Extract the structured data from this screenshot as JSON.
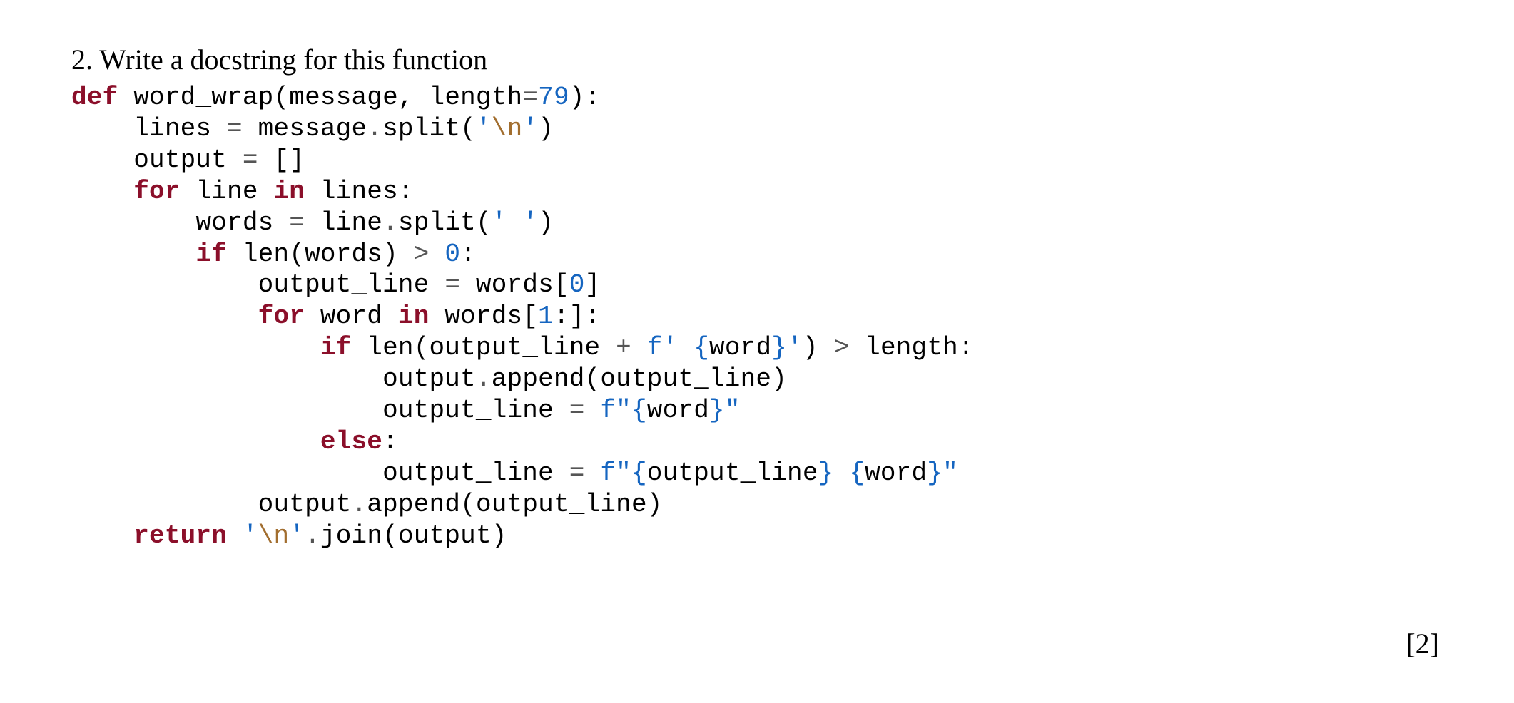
{
  "question": {
    "number": "2.",
    "prompt": "Write a docstring for this function"
  },
  "points_label": "[2]",
  "code": {
    "l1": {
      "kw_def": "def",
      "fname": " word_wrap",
      "lparen": "(",
      "arg1": "message",
      "comma": ", ",
      "arg2": "length",
      "eq": "=",
      "default": "79",
      "rparen": ")",
      "colon": ":"
    },
    "l2": {
      "indent": "    ",
      "lhs": "lines ",
      "eq": "=",
      "rhs1": " message",
      "dot": ".",
      "call": "split",
      "lparen": "(",
      "q1": "'",
      "esc": "\\n",
      "q2": "'",
      "rparen": ")"
    },
    "l3": {
      "indent": "    ",
      "lhs": "output ",
      "eq": "=",
      "sp": " ",
      "lbracket": "[",
      "rbracket": "]"
    },
    "l4": {
      "indent": "    ",
      "kw_for": "for",
      "var": " line ",
      "kw_in": "in",
      "iter": " lines",
      "colon": ":"
    },
    "l5": {
      "indent": "        ",
      "lhs": "words ",
      "eq": "=",
      "rhs1": " line",
      "dot": ".",
      "call": "split",
      "lparen": "(",
      "q1": "'",
      "sp": " ",
      "q2": "'",
      "rparen": ")"
    },
    "l6": {
      "indent": "        ",
      "kw_if": "if",
      "sp": " ",
      "fn": "len",
      "lparen": "(",
      "arg": "words",
      "rparen": ")",
      "sp2": " ",
      "gt": ">",
      "sp3": " ",
      "zero": "0",
      "colon": ":"
    },
    "l7": {
      "indent": "            ",
      "lhs": "output_line ",
      "eq": "=",
      "rhs": " words",
      "lbracket": "[",
      "idx": "0",
      "rbracket": "]"
    },
    "l8": {
      "indent": "            ",
      "kw_for": "for",
      "var": " word ",
      "kw_in": "in",
      "iter": " words",
      "lbracket": "[",
      "start": "1",
      "colon_slice": ":",
      "rbracket": "]",
      "colon": ":"
    },
    "l9": {
      "indent": "                ",
      "kw_if": "if",
      "sp": " ",
      "fn": "len",
      "lparen": "(",
      "arg1": "output_line ",
      "plus": "+",
      "sp2": " ",
      "fpfx": "f",
      "q1": "'",
      "lit_sp": " ",
      "lbrace": "{",
      "expr": "word",
      "rbrace": "}",
      "q2": "'",
      "rparen": ")",
      "sp3": " ",
      "gt": ">",
      "sp4": " ",
      "rhs": "length",
      "colon": ":"
    },
    "l10": {
      "indent": "                    ",
      "obj": "output",
      "dot": ".",
      "call": "append",
      "lparen": "(",
      "arg": "output_line",
      "rparen": ")"
    },
    "l11": {
      "indent": "                    ",
      "lhs": "output_line ",
      "eq": "=",
      "sp": " ",
      "fpfx": "f",
      "q1": "\"",
      "lbrace": "{",
      "expr": "word",
      "rbrace": "}",
      "q2": "\""
    },
    "l12": {
      "indent": "                ",
      "kw_else": "else",
      "colon": ":"
    },
    "l13": {
      "indent": "                    ",
      "lhs": "output_line ",
      "eq": "=",
      "sp": " ",
      "fpfx": "f",
      "q1": "\"",
      "lbrace1": "{",
      "expr1": "output_line",
      "rbrace1": "}",
      "lit_sp": " ",
      "lbrace2": "{",
      "expr2": "word",
      "rbrace2": "}",
      "q2": "\""
    },
    "l14": {
      "indent": "            ",
      "obj": "output",
      "dot": ".",
      "call": "append",
      "lparen": "(",
      "arg": "output_line",
      "rparen": ")"
    },
    "l15": {
      "indent": "    ",
      "kw_return": "return",
      "sp": " ",
      "q1": "'",
      "esc": "\\n",
      "q2": "'",
      "dot": ".",
      "call": "join",
      "lparen": "(",
      "arg": "output",
      "rparen": ")"
    }
  }
}
